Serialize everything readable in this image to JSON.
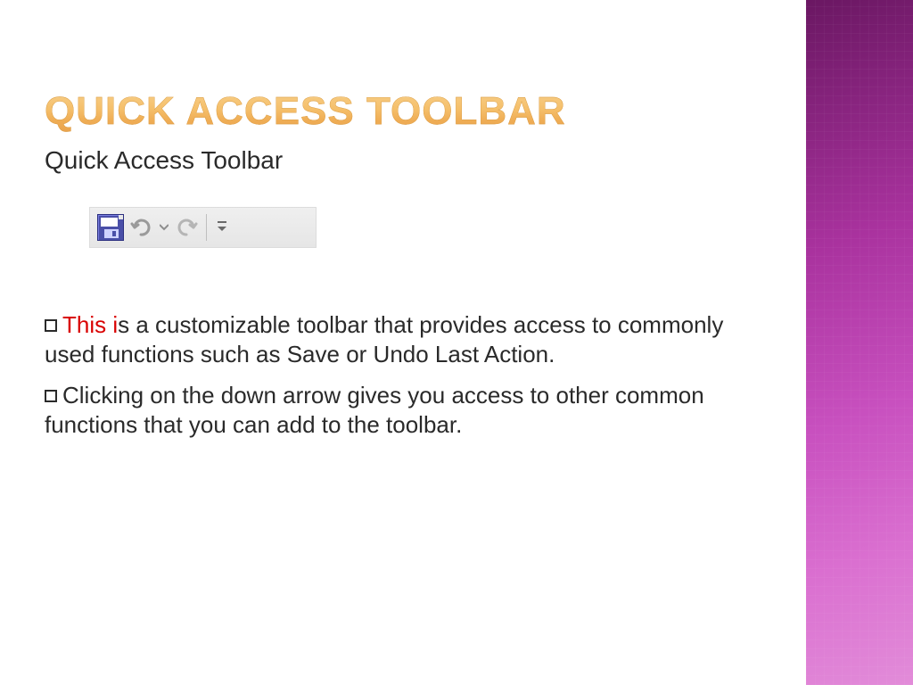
{
  "title": "QUICK ACCESS TOOLBAR",
  "subtitle": "Quick Access Toolbar",
  "toolbar": {
    "icons": {
      "save": "save-icon",
      "undo": "undo-icon",
      "undo_menu": "undo-menu-caret-icon",
      "redo": "redo-icon",
      "customize": "customize-qat-icon"
    }
  },
  "bullets": [
    {
      "highlight": "This i",
      "rest": "s a customizable toolbar that provides access to commonly used functions such as Save or Undo Last Action."
    },
    {
      "highlight": "",
      "rest": "Clicking on the down arrow gives you access to other common functions that you can add to the toolbar."
    }
  ],
  "colors": {
    "title_gradient_top": "#f7d08c",
    "title_gradient_bottom": "#e9a24c",
    "accent_red": "#d90000",
    "side_purple_top": "#6a1762",
    "side_purple_bottom": "#e28cd9"
  }
}
